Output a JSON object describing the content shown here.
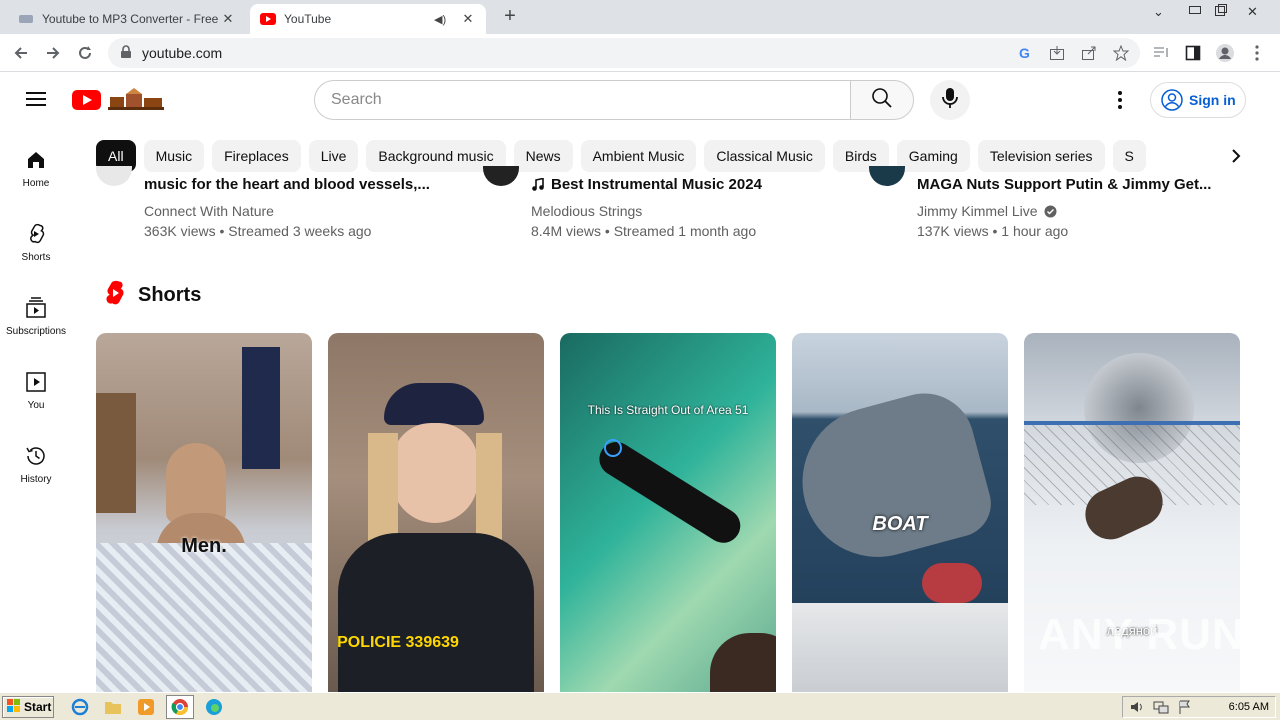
{
  "browser": {
    "tabs": [
      {
        "title": "Youtube to MP3 Converter - Free MP3",
        "active": false
      },
      {
        "title": "YouTube",
        "active": true
      }
    ],
    "url": "youtube.com",
    "new_tab_label": "+"
  },
  "header": {
    "search_placeholder": "Search",
    "sign_in_label": "Sign in"
  },
  "sidebar": {
    "items": [
      {
        "label": "Home",
        "icon": "home-icon"
      },
      {
        "label": "Shorts",
        "icon": "shorts-icon"
      },
      {
        "label": "Subscriptions",
        "icon": "subscriptions-icon"
      },
      {
        "label": "You",
        "icon": "you-icon"
      },
      {
        "label": "History",
        "icon": "history-icon"
      }
    ]
  },
  "chips": [
    "All",
    "Music",
    "Fireplaces",
    "Live",
    "Background music",
    "News",
    "Ambient Music",
    "Classical Music",
    "Birds",
    "Gaming",
    "Television series",
    "S"
  ],
  "videos": [
    {
      "title": "music for the heart and blood vessels,...",
      "channel": "Connect With Nature",
      "stats": "363K views • Streamed 3 weeks ago"
    },
    {
      "title": "Best Instrumental Music 2024",
      "channel": "Melodious Strings",
      "stats": "8.4M views • Streamed 1 month ago"
    },
    {
      "title": "MAGA Nuts Support Putin & Jimmy Get...",
      "channel": "Jimmy Kimmel Live",
      "stats": "137K views • 1 hour ago"
    }
  ],
  "shorts": {
    "title": "Shorts",
    "items": [
      {
        "overlay": "Men."
      },
      {
        "overlay": "POLICIE 339639"
      },
      {
        "overlay": "This Is Straight Out of Area 51"
      },
      {
        "overlay": "BOAT"
      },
      {
        "overlay": "ледяной"
      }
    ]
  },
  "taskbar": {
    "start_label": "Start",
    "clock": "6:05 AM"
  },
  "watermark": "ANY RUN",
  "colors": {
    "yt_red": "#ff0000",
    "link_blue": "#065fd4",
    "chip_bg": "#f2f2f2",
    "chip_active_bg": "#0f0f0f"
  }
}
